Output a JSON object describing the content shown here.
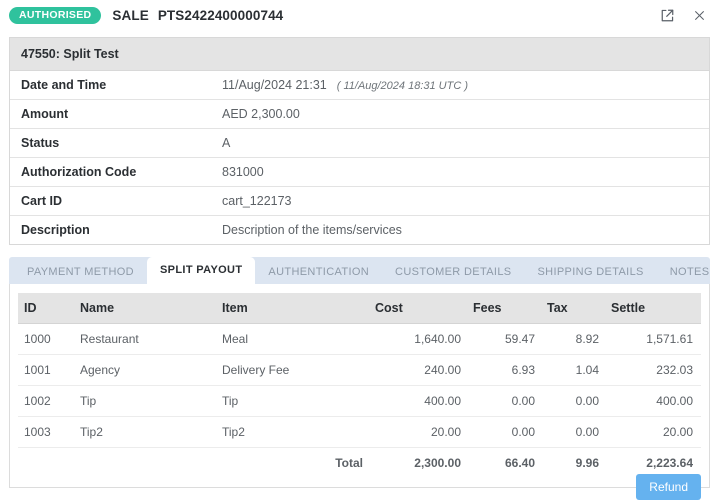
{
  "header": {
    "status_badge": "AUTHORISED",
    "transaction_type": "SALE",
    "transaction_id": "PTS2422400000744",
    "share_icon": "share-icon",
    "close_icon": "close-icon"
  },
  "details": {
    "title": "47550: Split Test",
    "rows": [
      {
        "label": "Date and Time",
        "value": "11/Aug/2024 21:31",
        "sub": "( 11/Aug/2024 18:31 UTC )"
      },
      {
        "label": "Amount",
        "value": "AED 2,300.00",
        "sub": ""
      },
      {
        "label": "Status",
        "value": "A",
        "sub": ""
      },
      {
        "label": "Authorization Code",
        "value": "831000",
        "sub": ""
      },
      {
        "label": "Cart ID",
        "value": "cart_122173",
        "sub": ""
      },
      {
        "label": "Description",
        "value": "Description of the items/services",
        "sub": ""
      }
    ]
  },
  "tabs": [
    {
      "label": "PAYMENT METHOD",
      "active": false
    },
    {
      "label": "SPLIT PAYOUT",
      "active": true
    },
    {
      "label": "AUTHENTICATION",
      "active": false
    },
    {
      "label": "CUSTOMER DETAILS",
      "active": false
    },
    {
      "label": "SHIPPING DETAILS",
      "active": false
    },
    {
      "label": "NOTES",
      "active": false
    }
  ],
  "payout_table": {
    "columns": [
      "ID",
      "Name",
      "Item",
      "Cost",
      "Fees",
      "Tax",
      "Settle"
    ],
    "rows": [
      {
        "id": "1000",
        "name": "Restaurant",
        "item": "Meal",
        "cost": "1,640.00",
        "fees": "59.47",
        "tax": "8.92",
        "settle": "1,571.61"
      },
      {
        "id": "1001",
        "name": "Agency",
        "item": "Delivery Fee",
        "cost": "240.00",
        "fees": "6.93",
        "tax": "1.04",
        "settle": "232.03"
      },
      {
        "id": "1002",
        "name": "Tip",
        "item": "Tip",
        "cost": "400.00",
        "fees": "0.00",
        "tax": "0.00",
        "settle": "400.00"
      },
      {
        "id": "1003",
        "name": "Tip2",
        "item": "Tip2",
        "cost": "20.00",
        "fees": "0.00",
        "tax": "0.00",
        "settle": "20.00"
      }
    ],
    "total": {
      "label": "Total",
      "cost": "2,300.00",
      "fees": "66.40",
      "tax": "9.96",
      "settle": "2,223.64"
    }
  },
  "footer": {
    "refund_label": "Refund"
  },
  "colors": {
    "badge_green": "#2fc29d",
    "refund_blue": "#65b2ef",
    "tab_strip": "#dce5f1",
    "header_grey": "#e4e4e4"
  }
}
